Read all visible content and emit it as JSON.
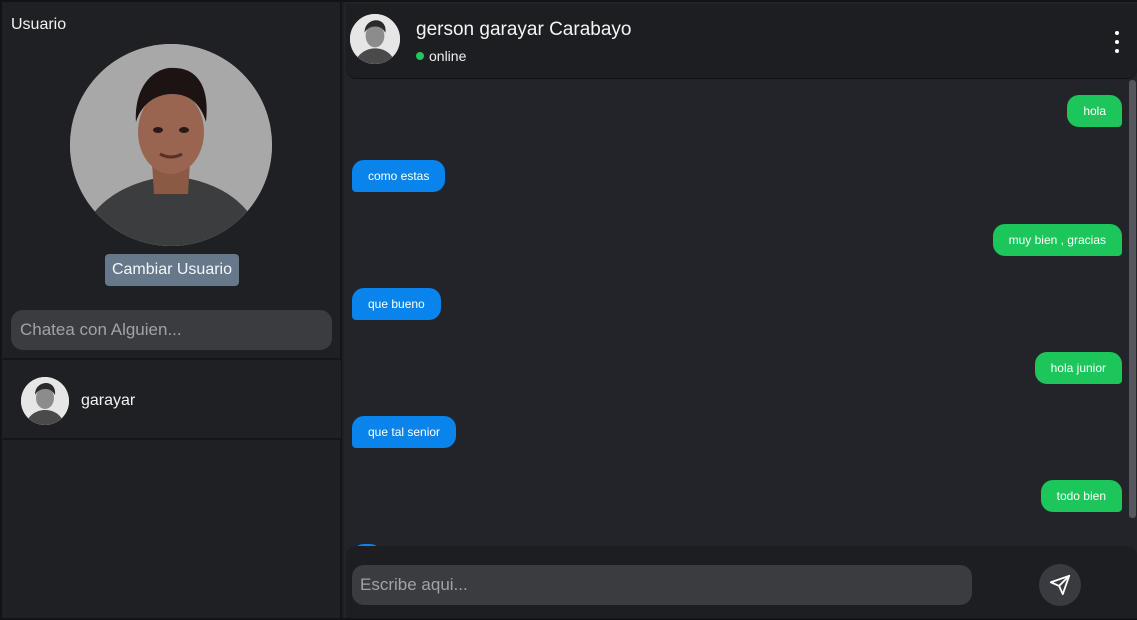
{
  "sidebar": {
    "title": "Usuario",
    "change_user_label": "Cambiar Usuario",
    "search_placeholder": "Chatea con Alguien...",
    "contacts": [
      {
        "name": "garayar"
      }
    ]
  },
  "chat": {
    "contact_name": "gerson garayar Carabayo",
    "status": "online",
    "input_placeholder": "Escribe aqui...",
    "messages": [
      {
        "text": "hola",
        "direction": "out"
      },
      {
        "text": "como estas",
        "direction": "in"
      },
      {
        "text": "muy bien , gracias",
        "direction": "out"
      },
      {
        "text": "que bueno",
        "direction": "in"
      },
      {
        "text": "hola junior",
        "direction": "out"
      },
      {
        "text": "que tal senior",
        "direction": "in"
      },
      {
        "text": "todo bien",
        "direction": "out"
      }
    ]
  },
  "colors": {
    "incoming": "#0a84ed",
    "outgoing": "#1cc65a",
    "online": "#22c55e",
    "change_button": "#66788a"
  },
  "icons": {
    "menu": "vertical-dots-icon",
    "send": "paper-plane-icon"
  }
}
